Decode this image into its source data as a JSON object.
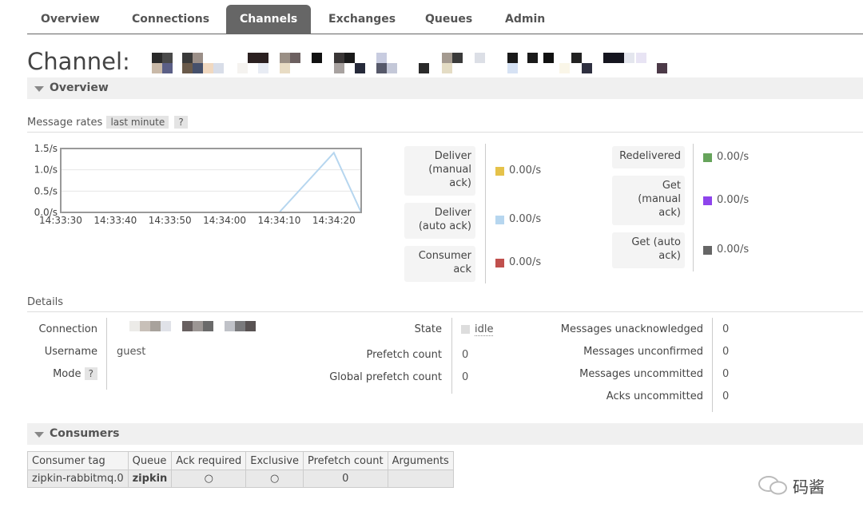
{
  "tabs": [
    "Overview",
    "Connections",
    "Channels",
    "Exchanges",
    "Queues",
    "Admin"
  ],
  "page": {
    "title": "Channel:"
  },
  "overview_section": {
    "title": "Overview"
  },
  "message_rates": {
    "label": "Message rates",
    "range": "last minute",
    "help": "?"
  },
  "chart_data": {
    "type": "line",
    "x": [
      "14:33:30",
      "14:33:40",
      "14:33:50",
      "14:34:00",
      "14:34:10",
      "14:34:20",
      "14:34:25"
    ],
    "series": [
      {
        "name": "Deliver (auto ack)",
        "values": [
          0,
          0,
          0,
          0,
          0,
          1.4,
          0
        ]
      }
    ],
    "ytick_labels": [
      "0.0/s",
      "0.5/s",
      "1.0/s",
      "1.5/s"
    ],
    "xtick_labels": [
      "14:33:30",
      "14:33:40",
      "14:33:50",
      "14:34:00",
      "14:34:10",
      "14:34:20"
    ],
    "ylim": [
      0,
      1.5
    ],
    "grid": true
  },
  "rates_left": [
    {
      "label": "Deliver (manual ack)",
      "value": "0.00/s",
      "color": "#e5c24a"
    },
    {
      "label": "Deliver (auto ack)",
      "value": "0.00/s",
      "color": "#b6d6ef"
    },
    {
      "label": "Consumer ack",
      "value": "0.00/s",
      "color": "#c0504d"
    }
  ],
  "rates_right": [
    {
      "label": "Redelivered",
      "value": "0.00/s",
      "color": "#66a45b"
    },
    {
      "label": "Get (manual ack)",
      "value": "0.00/s",
      "color": "#8e44ec"
    },
    {
      "label": "Get (auto ack)",
      "value": "0.00/s",
      "color": "#666666"
    }
  ],
  "details": {
    "title": "Details",
    "connection_label": "Connection",
    "username_label": "Username",
    "username": "guest",
    "mode_label": "Mode",
    "mode_help": "?",
    "state_label": "State",
    "state": "idle",
    "prefetch_label": "Prefetch count",
    "prefetch": "0",
    "global_prefetch_label": "Global prefetch count",
    "global_prefetch": "0",
    "unacked_label": "Messages unacknowledged",
    "unacked": "0",
    "unconfirmed_label": "Messages unconfirmed",
    "unconfirmed": "0",
    "uncommitted_label": "Messages uncommitted",
    "uncommitted": "0",
    "acks_uncommitted_label": "Acks uncommitted",
    "acks_uncommitted": "0"
  },
  "consumers": {
    "title": "Consumers",
    "headers": [
      "Consumer tag",
      "Queue",
      "Ack required",
      "Exclusive",
      "Prefetch count",
      "Arguments"
    ],
    "rows": [
      {
        "tag": "zipkin-rabbitmq.0",
        "queue": "zipkin",
        "ack_required": "○",
        "exclusive": "○",
        "prefetch": "0",
        "arguments": ""
      }
    ]
  },
  "watermark": {
    "text": "码酱"
  },
  "colors": {
    "tab_active": "#666666",
    "section_bar": "#f0f0f0",
    "chart_line": "#b6d6ef"
  }
}
